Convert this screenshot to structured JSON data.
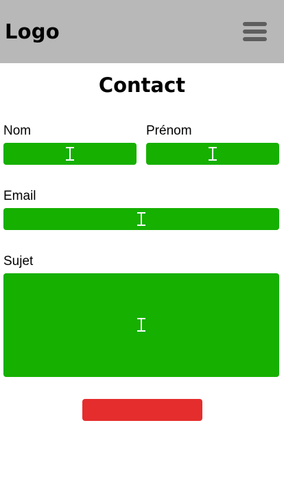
{
  "header": {
    "logo_text": "Logo",
    "menu_icon": "hamburger-menu-icon"
  },
  "page": {
    "title": "Contact"
  },
  "form": {
    "nom_label": "Nom",
    "prenom_label": "Prénom",
    "email_label": "Email",
    "sujet_label": "Sujet",
    "submit_label": ""
  },
  "colors": {
    "header_bg": "#b8b8b8",
    "field_bg": "#16b000",
    "submit_bg": "#e52d2d",
    "menu_icon": "#5e5e5e"
  }
}
